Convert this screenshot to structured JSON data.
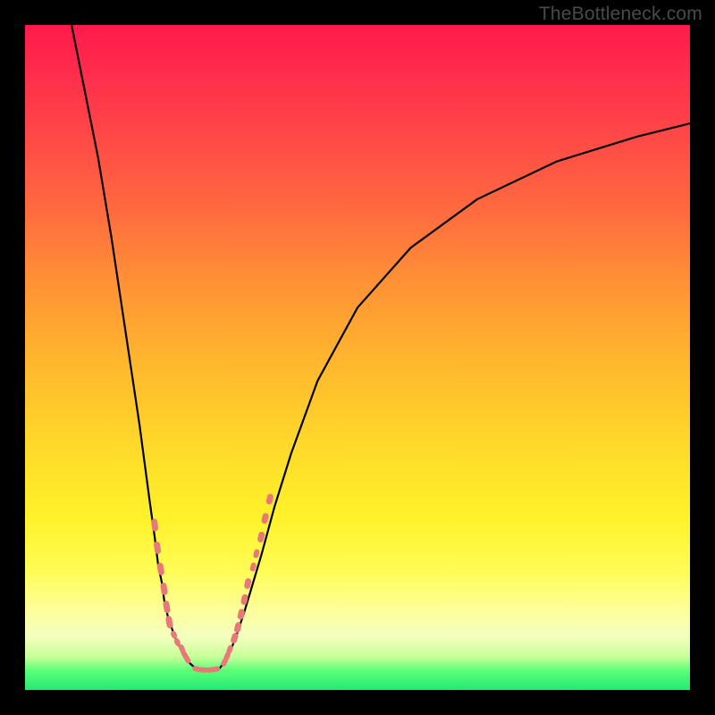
{
  "watermark": "TheBottleneck.com",
  "colors": {
    "frame": "#000000",
    "gradient_top": "#ff1a4d",
    "gradient_bottom": "#22e873",
    "curve": "#000000",
    "bead": "#e77a78"
  },
  "chart_data": {
    "type": "line",
    "title": "",
    "xlabel": "",
    "ylabel": "",
    "xlim": [
      0,
      100
    ],
    "ylim": [
      0,
      100
    ],
    "series": [
      {
        "name": "left-branch",
        "x": [
          7,
          9,
          11,
          13,
          14.5,
          16,
          17.2,
          18,
          18.8,
          19.5,
          20.0,
          20.6,
          21.0,
          21.5,
          22.0,
          22.6,
          23.3,
          24.0,
          24.8,
          25.6
        ],
        "values": [
          100,
          90,
          80,
          68,
          58,
          48,
          40,
          34,
          28,
          23,
          19,
          16,
          13,
          11,
          9.5,
          7.8,
          6.4,
          5.1,
          4.0,
          3.3
        ]
      },
      {
        "name": "floor",
        "x": [
          25.6,
          26.5,
          27.5,
          28.5,
          29.3
        ],
        "values": [
          3.3,
          3.0,
          3.0,
          3.1,
          3.3
        ]
      },
      {
        "name": "right-branch",
        "x": [
          29.3,
          30.2,
          31.1,
          32.0,
          33.0,
          34.2,
          35.6,
          37.5,
          40,
          44,
          50,
          58,
          68,
          80,
          92,
          100
        ],
        "values": [
          3.3,
          4.5,
          6.4,
          8.8,
          11.8,
          15.8,
          20.5,
          27.5,
          35.5,
          46.5,
          57.5,
          66.5,
          73.8,
          79.5,
          83.2,
          85.2
        ]
      }
    ],
    "bead_groups": [
      {
        "xs": [
          19.5,
          19.9,
          20.4,
          20.9,
          21.3,
          21.7
        ],
        "ys": [
          24.8,
          21.4,
          18.2,
          15.2,
          12.5,
          10.2
        ],
        "len": 14,
        "wid": 7
      },
      {
        "xs": [
          22.4,
          22.9
        ],
        "ys": [
          8.3,
          7.2
        ],
        "len": 9,
        "wid": 6
      },
      {
        "xs": [
          23.6,
          24.0,
          24.4
        ],
        "ys": [
          6.2,
          5.3,
          4.6
        ],
        "len": 10,
        "wid": 6
      },
      {
        "xs": [
          25.7,
          26.3,
          26.9,
          27.6,
          28.2,
          28.8
        ],
        "ys": [
          3.2,
          3.05,
          3.0,
          3.0,
          3.05,
          3.15
        ],
        "len": 8,
        "wid": 6
      },
      {
        "xs": [
          30.0,
          30.4,
          30.8
        ],
        "ys": [
          4.2,
          5.1,
          6.1
        ],
        "len": 10,
        "wid": 6
      },
      {
        "xs": [
          31.5,
          32.0,
          32.5,
          33.0,
          33.5
        ],
        "ys": [
          7.8,
          9.4,
          11.4,
          13.6,
          16.0
        ],
        "len": 12,
        "wid": 7
      },
      {
        "xs": [
          34.3,
          34.8
        ],
        "ys": [
          18.5,
          20.5
        ],
        "len": 10,
        "wid": 6
      },
      {
        "xs": [
          35.5,
          36.1,
          36.8
        ],
        "ys": [
          23.0,
          25.8,
          28.7
        ],
        "len": 12,
        "wid": 7
      }
    ]
  }
}
